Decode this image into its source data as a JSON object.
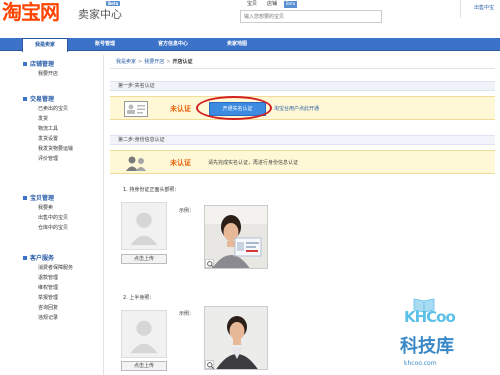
{
  "header": {
    "logo_main": "淘宝网",
    "logo_badge": "Beta",
    "logo_sub": "卖家中心",
    "search_tabs": [
      "宝贝",
      "店铺",
      "Beta"
    ],
    "search_placeholder": "输入您想要的宝贝",
    "right_link": "出售中宝"
  },
  "nav": {
    "tabs": [
      "我是卖家",
      "账号管理",
      "官方信息中心",
      "卖家地图"
    ]
  },
  "sidebar": {
    "sections": [
      {
        "title": "店铺管理",
        "items": [
          "我要开店"
        ]
      },
      {
        "title": "交易管理",
        "items": [
          "已卖出的宝贝",
          "发货",
          "物流工具",
          "发货设置",
          "我发货物要运输",
          "评价管理"
        ]
      },
      {
        "title": "宝贝管理",
        "items": [
          "我要卖",
          "出售中的宝贝",
          "仓库中的宝贝"
        ]
      },
      {
        "title": "客户服务",
        "items": [
          "消费者保障服务",
          "退款管理",
          "维权管理",
          "举报管理",
          "咨询回复",
          "违规记录"
        ]
      }
    ]
  },
  "main": {
    "breadcrumb": [
      "我是卖家",
      "我要开店",
      "开店认证"
    ],
    "step1": {
      "title": "第一步:实名认证",
      "status": "未认证",
      "button": "开通实名认证",
      "hint": "淘宝台用户点此开通"
    },
    "step2": {
      "title": "第二步:身份信息认证",
      "status": "未认证",
      "hint": "请先完成实名认证，再进行身份信息认证"
    },
    "photo1": {
      "label": "1. 持身份证正面头部照：",
      "example": "示例：",
      "upload": "点击上传"
    },
    "photo2": {
      "label": "2. 上半身照：",
      "example": "示例：",
      "upload": "点击上传"
    }
  },
  "watermark": {
    "brand": "KHCoo",
    "cn": "科技库",
    "url": "khcoo.com"
  },
  "colors": {
    "brand_orange": "#ff4400",
    "nav_blue": "#3c73c8",
    "status_orange": "#e8620a",
    "highlight_red": "#d22020"
  }
}
